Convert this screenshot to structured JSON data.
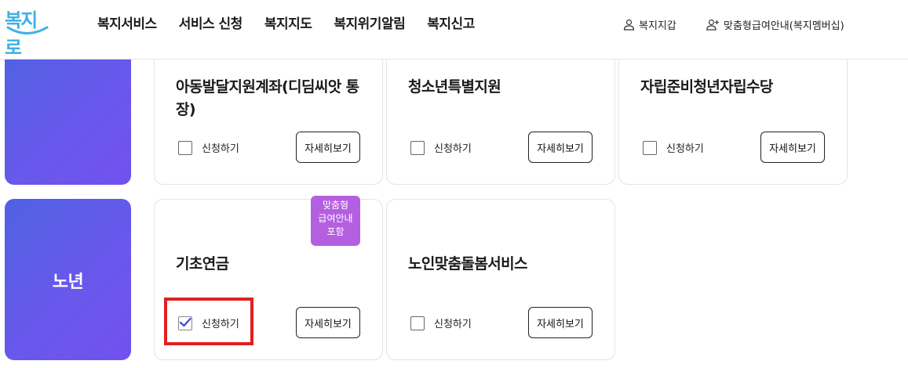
{
  "logo": {
    "text": "복지로"
  },
  "nav": [
    {
      "label": "복지서비스"
    },
    {
      "label": "서비스 신청"
    },
    {
      "label": "복지지도"
    },
    {
      "label": "복지위기알림"
    },
    {
      "label": "복지신고"
    }
  ],
  "util": {
    "wallet": "복지지갑",
    "membership": "맞춤형급여안내(복지멤버십)"
  },
  "categories": {
    "elderly": "노년"
  },
  "cards": [
    {
      "title": "아동발달지원계좌(디딤씨앗 통장)",
      "apply_label": "신청하기",
      "detail_label": "자세히보기",
      "checked": false
    },
    {
      "title": "청소년특별지원",
      "apply_label": "신청하기",
      "detail_label": "자세히보기",
      "checked": false
    },
    {
      "title": "자립준비청년자립수당",
      "apply_label": "신청하기",
      "detail_label": "자세히보기",
      "checked": false
    },
    {
      "title": "기초연금",
      "apply_label": "신청하기",
      "detail_label": "자세히보기",
      "checked": true
    },
    {
      "title": "노인맞춤돌봄서비스",
      "apply_label": "신청하기",
      "detail_label": "자세히보기",
      "checked": false
    }
  ],
  "badge": {
    "line1": "맞춤형",
    "line2": "급여안내",
    "line3": "포함"
  },
  "colors": {
    "category_tile": "#5a5de8",
    "badge": "#b45fe0",
    "highlight": "#e02020",
    "check": "#3a56d4"
  }
}
